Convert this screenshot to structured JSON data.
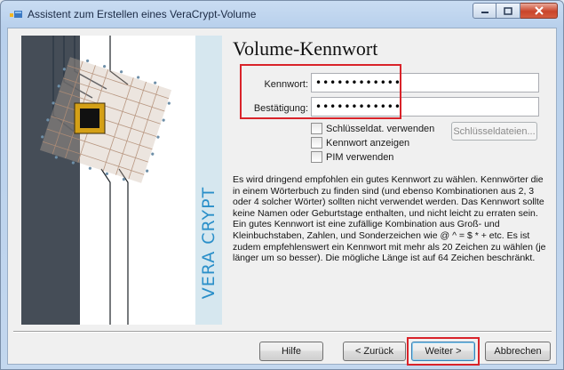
{
  "window": {
    "title": "Assistent zum Erstellen eines VeraCrypt-Volume",
    "minimize_icon": "minimize-icon",
    "maximize_icon": "maximize-icon",
    "close_icon": "close-icon"
  },
  "banner": {
    "brand_text": "VERA CRYPT",
    "brand_color": "#2a8fc9"
  },
  "page": {
    "title": "Volume-Kennwort",
    "password_label": "Kennwort:",
    "password_value": "••••••••••••",
    "confirm_label": "Bestätigung:",
    "confirm_value": "••••••••••••",
    "options": {
      "keyfiles_label": "Schlüsseldat. verwenden",
      "keyfiles_button": "Schlüsseldateien...",
      "show_password_label": "Kennwort anzeigen",
      "pim_label": "PIM verwenden"
    },
    "info_text": "Es wird dringend empfohlen ein gutes Kennwort zu wählen. Kennwörter die in einem Wörterbuch zu finden sind (und ebenso Kombinationen aus 2, 3 oder 4 solcher Wörter) sollten nicht verwendet werden. Das Kennwort sollte keine Namen oder Geburtstage enthalten, und nicht leicht zu erraten sein. Ein gutes Kennwort ist eine zufällige Kombination aus Groß- und Kleinbuchstaben, Zahlen, und Sonderzeichen wie @ ^ = $ * + etc. Es ist zudem empfehlenswert ein Kennwort mit mehr als 20 Zeichen zu wählen (je länger um so besser). Die mögliche Länge ist auf 64 Zeichen beschränkt."
  },
  "footer": {
    "help": "Hilfe",
    "back": "< Zurück",
    "next": "Weiter >",
    "cancel": "Abbrechen"
  },
  "colors": {
    "highlight": "#d9232a",
    "accent": "#3c7fb1"
  }
}
